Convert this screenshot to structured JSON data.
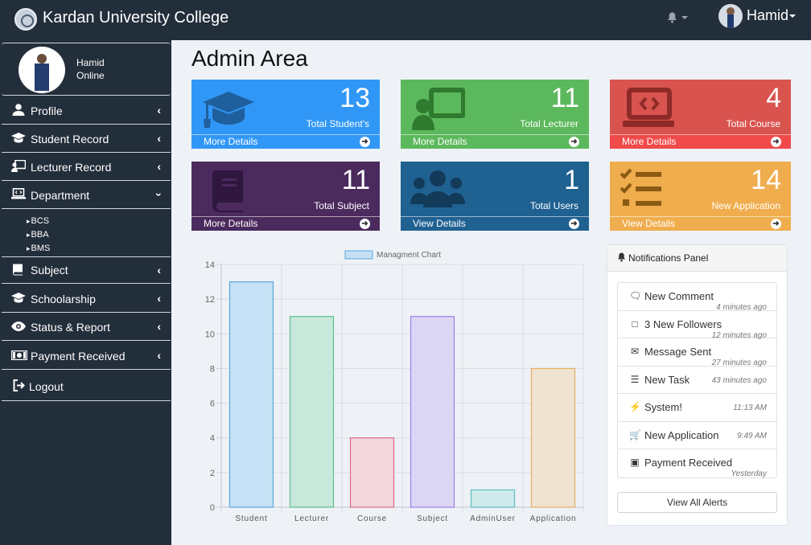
{
  "header": {
    "brand": "Kardan University College",
    "user_name": "Hamid"
  },
  "sidebar": {
    "user": {
      "name": "Hamid",
      "status": "Online"
    },
    "items": [
      {
        "label": "Profile",
        "icon": "user-icon"
      },
      {
        "label": "Student Record",
        "icon": "graduation-cap-icon"
      },
      {
        "label": "Lecturer Record",
        "icon": "teacher-board-icon"
      },
      {
        "label": "Department",
        "icon": "laptop-code-icon"
      },
      {
        "label": "Subject",
        "icon": "book-icon"
      },
      {
        "label": "Schoolarship",
        "icon": "graduation-cap-icon"
      },
      {
        "label": "Status & Report",
        "icon": "eye-icon"
      },
      {
        "label": "Payment Received",
        "icon": "money-icon"
      },
      {
        "label": "Logout",
        "icon": "sign-out-icon"
      }
    ],
    "department_sub": [
      "BCS",
      "BBA",
      "BMS"
    ]
  },
  "main": {
    "title": "Admin Area",
    "cards": [
      {
        "value": "13",
        "label": "Total Student's",
        "link": "More Details",
        "color": "#3097f6",
        "icon": "graduation-cap-icon"
      },
      {
        "value": "11",
        "label": "Total Lecturer",
        "link": "More Details",
        "color": "#5cb85c",
        "icon": "teacher-board-icon"
      },
      {
        "value": "4",
        "label": "Total Course",
        "link": "More Details",
        "color": "#d9534f",
        "icon": "laptop-code-icon"
      },
      {
        "value": "11",
        "label": "Total Subject",
        "link": "More Details",
        "color": "#4b2a5e",
        "icon": "book-icon"
      },
      {
        "value": "1",
        "label": "Total Users",
        "link": "View Details",
        "color": "#1f6191",
        "icon": "users-icon"
      },
      {
        "value": "14",
        "label": "New Application",
        "link": "View Details",
        "color": "#f0ad4e",
        "icon": "tasks-icon"
      }
    ]
  },
  "chart_data": {
    "type": "bar",
    "legend": "Managment Chart",
    "categories": [
      "Student",
      "Lecturer",
      "Course",
      "Subject",
      "AdminUser",
      "Application"
    ],
    "values": [
      13,
      11,
      4,
      11,
      1,
      8
    ],
    "ylim": [
      0,
      14
    ],
    "yticks": [
      "0",
      "2",
      "4",
      "6",
      "8",
      "10",
      "12",
      "14"
    ],
    "colors": [
      "#c6e1f5",
      "#c8e8dc",
      "#f2d6de",
      "#dcd6f5",
      "#cfeaea",
      "#f0e3d1"
    ],
    "borders": [
      "#5aa7e0",
      "#5cbf8c",
      "#e06a82",
      "#9b82e8",
      "#5cbfbf",
      "#e8ad62"
    ],
    "grid": true
  },
  "notifications": {
    "title": "Notifications Panel",
    "items": [
      {
        "icon": "comment-icon",
        "text": "New Comment",
        "time": "4 minutes ago",
        "pos": "low"
      },
      {
        "icon": "twitter-icon",
        "text": "3 New Followers",
        "time": "12 minutes ago",
        "pos": "low"
      },
      {
        "icon": "envelope-icon",
        "text": "Message Sent",
        "time": "27 minutes ago",
        "pos": "low"
      },
      {
        "icon": "tasks-icon",
        "text": "New Task",
        "time": "43 minutes ago",
        "pos": "mid"
      },
      {
        "icon": "bolt-icon",
        "text": "System!",
        "time": "11:13 AM",
        "pos": "mid"
      },
      {
        "icon": "cart-icon",
        "text": "New Application",
        "time": "9:49 AM",
        "pos": "mid"
      },
      {
        "icon": "money-icon",
        "text": "Payment Received",
        "time": "Yesterday",
        "pos": "low"
      }
    ],
    "view_all": "View All Alerts"
  }
}
